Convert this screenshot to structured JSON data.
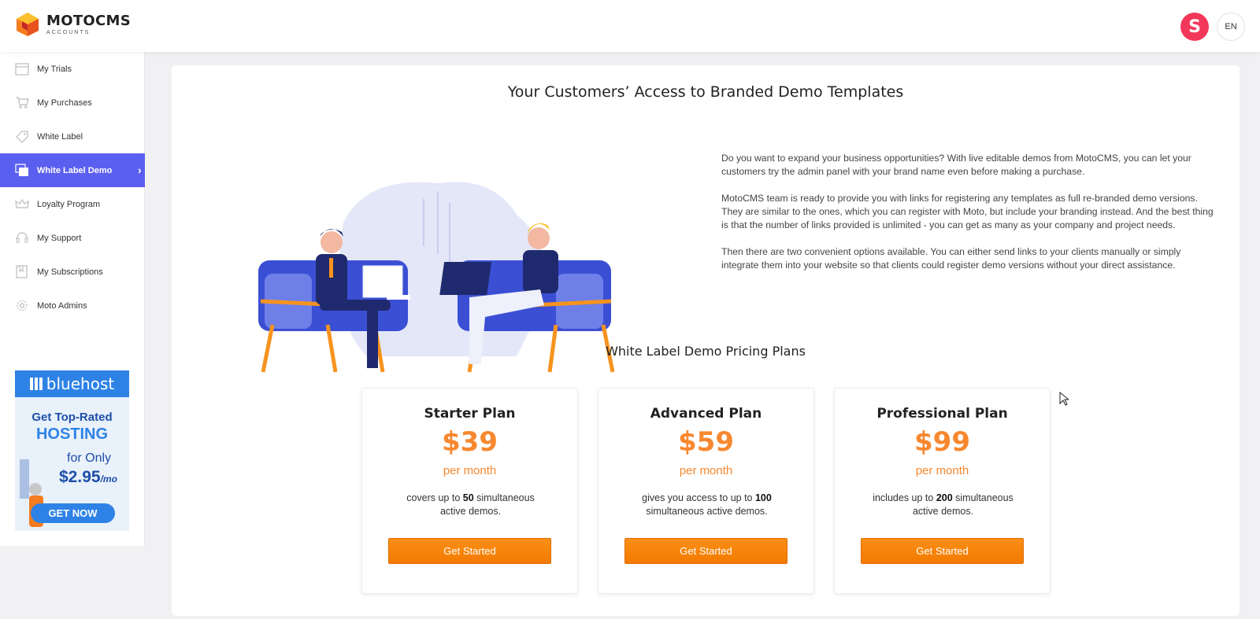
{
  "header": {
    "logo_name": "MOTOCMS",
    "logo_sub": "ACCOUNTS",
    "avatar_letter": "S",
    "language": "EN",
    "avatar_color": "#f2375b"
  },
  "sidebar": {
    "items": [
      {
        "label": "My Trials",
        "icon": "calendar-icon"
      },
      {
        "label": "My Purchases",
        "icon": "cart-icon"
      },
      {
        "label": "White Label",
        "icon": "tag-icon"
      },
      {
        "label": "White Label Demo",
        "icon": "windows-icon",
        "active": true
      },
      {
        "label": "Loyalty Program",
        "icon": "crown-icon"
      },
      {
        "label": "My Support",
        "icon": "headset-icon"
      },
      {
        "label": "My Subscriptions",
        "icon": "bookmark-icon"
      },
      {
        "label": "Moto Admins",
        "icon": "gear-icon"
      }
    ],
    "active_color": "#5b5ff0"
  },
  "ad": {
    "brand": "bluehost",
    "line1": "Get Top-Rated",
    "line2": "HOSTING",
    "line3": "for Only",
    "price": "$2.95",
    "price_unit": "/mo",
    "cta": "GET NOW"
  },
  "main": {
    "title": "Your Customers’ Access to Branded Demo Templates",
    "paragraphs": [
      "Do you want to expand your business opportunities? With live editable demos from MotoCMS, you can let your customers try the admin panel with your brand name even before making a purchase.",
      "MotoCMS team is ready to provide you with links for registering any templates as full re-branded demo versions. They are similar to the ones, which you can register with Moto, but include your branding instead. And the best thing is that the number of links provided is unlimited - you can get as many as your company and project needs.",
      "Then there are two convenient options available. You can either send links to your clients manually or simply integrate them into your website so that clients could register demo versions without your direct assistance."
    ],
    "pricing_title": "White Label Demo Pricing Plans",
    "accent_color": "#f7882f"
  },
  "plans": [
    {
      "name": "Starter Plan",
      "price": "$39",
      "period": "per month",
      "desc_before": "covers up to ",
      "desc_bold": "50",
      "desc_after": " simultaneous active demos.",
      "button": "Get Started"
    },
    {
      "name": "Advanced Plan",
      "price": "$59",
      "period": "per month",
      "desc_before": "gives you access to up to ",
      "desc_bold": "100",
      "desc_after": " simultaneous active demos.",
      "button": "Get Started"
    },
    {
      "name": "Professional Plan",
      "price": "$99",
      "period": "per month",
      "desc_before": "includes up to ",
      "desc_bold": "200",
      "desc_after": " simultaneous active demos.",
      "button": "Get Started"
    }
  ]
}
